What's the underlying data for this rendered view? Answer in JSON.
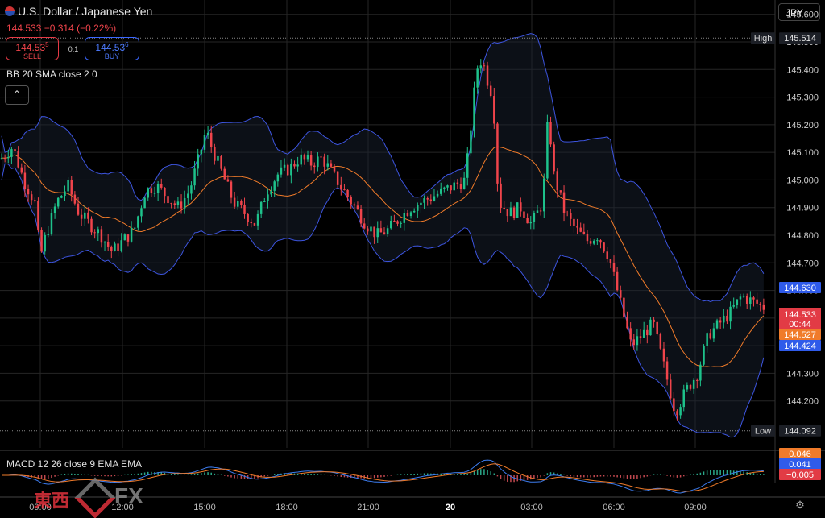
{
  "header": {
    "symbol": "U.S. Dollar / Japanese Yen",
    "last": "144.533",
    "change": "−0.314 (−0.22%)",
    "sell_price": "144.53",
    "sell_sup": "5",
    "sell_label": "SELL",
    "buy_price": "144.53",
    "buy_sup": "6",
    "buy_label": "BUY",
    "spread": "0.1",
    "currency": "JPY",
    "collapse_icon": "chevron-up-icon"
  },
  "indicators": {
    "bb_label": "BB 20 SMA close 2 0",
    "macd_label": "MACD 12 26 close 9 EMA EMA"
  },
  "logo": {
    "kanji": "東西",
    "text": "FX"
  },
  "colors": {
    "up": "#1ec28b",
    "down": "#f0444b",
    "bb_band": "#3d55e0",
    "bb_basis": "#f07b2a",
    "macd": "#3d7df0",
    "signal": "#f07b2a",
    "grid": "#262626"
  },
  "chart_data": {
    "type": "candlestick",
    "title": "U.S. Dollar / Japanese Yen",
    "ylim": [
      144.03,
      145.64
    ],
    "y_ticks": [
      "145.600",
      "145.500",
      "145.400",
      "145.300",
      "145.200",
      "145.100",
      "145.000",
      "144.900",
      "144.800",
      "144.700",
      "144.600",
      "144.500",
      "144.400",
      "144.300",
      "144.200"
    ],
    "x_ticks": [
      "09:00",
      "12:00",
      "15:00",
      "18:00",
      "21:00",
      "20",
      "03:00",
      "06:00",
      "09:00"
    ],
    "high": {
      "label": "High",
      "value": "145.514"
    },
    "low": {
      "label": "Low",
      "value": "144.092"
    },
    "upper_band_value": "144.630",
    "last_price": "144.533",
    "countdown": "00:44",
    "basis_value": "144.527",
    "lower_band_value": "144.424",
    "close_path": [
      [
        0,
        145.08
      ],
      [
        2,
        145.12
      ],
      [
        4,
        145.0
      ],
      [
        6,
        144.92
      ],
      [
        7,
        144.72
      ],
      [
        8,
        144.8
      ],
      [
        10,
        144.92
      ],
      [
        12,
        144.98
      ],
      [
        14,
        144.88
      ],
      [
        16,
        144.84
      ],
      [
        18,
        144.8
      ],
      [
        20,
        144.74
      ],
      [
        22,
        144.78
      ],
      [
        24,
        144.82
      ],
      [
        26,
        144.96
      ],
      [
        28,
        144.98
      ],
      [
        30,
        144.94
      ],
      [
        32,
        144.9
      ],
      [
        34,
        144.96
      ],
      [
        36,
        145.1
      ],
      [
        37,
        145.18
      ],
      [
        38,
        145.12
      ],
      [
        40,
        145.02
      ],
      [
        42,
        144.92
      ],
      [
        44,
        144.88
      ],
      [
        46,
        144.84
      ],
      [
        48,
        144.96
      ],
      [
        50,
        145.02
      ],
      [
        52,
        145.04
      ],
      [
        54,
        145.08
      ],
      [
        56,
        145.06
      ],
      [
        58,
        145.08
      ],
      [
        60,
        145.02
      ],
      [
        62,
        144.96
      ],
      [
        64,
        144.9
      ],
      [
        66,
        144.84
      ],
      [
        68,
        144.8
      ],
      [
        70,
        144.82
      ],
      [
        72,
        144.86
      ],
      [
        74,
        144.9
      ],
      [
        76,
        144.92
      ],
      [
        78,
        144.94
      ],
      [
        80,
        144.96
      ],
      [
        82,
        144.98
      ],
      [
        84,
        145.0
      ],
      [
        86,
        145.4
      ],
      [
        87,
        145.44
      ],
      [
        88,
        145.36
      ],
      [
        89,
        145.3
      ],
      [
        90,
        144.92
      ],
      [
        92,
        144.88
      ],
      [
        94,
        144.9
      ],
      [
        96,
        144.84
      ],
      [
        98,
        144.92
      ],
      [
        99,
        145.24
      ],
      [
        100,
        145.02
      ],
      [
        102,
        144.88
      ],
      [
        104,
        144.82
      ],
      [
        106,
        144.78
      ],
      [
        108,
        144.8
      ],
      [
        110,
        144.72
      ],
      [
        112,
        144.56
      ],
      [
        114,
        144.4
      ],
      [
        116,
        144.44
      ],
      [
        118,
        144.48
      ],
      [
        120,
        144.32
      ],
      [
        122,
        144.16
      ],
      [
        124,
        144.24
      ],
      [
        126,
        144.3
      ],
      [
        128,
        144.44
      ],
      [
        130,
        144.48
      ],
      [
        132,
        144.52
      ],
      [
        134,
        144.58
      ],
      [
        136,
        144.56
      ],
      [
        138,
        144.54
      ]
    ],
    "macd": {
      "value": "0.041",
      "signal": "0.046",
      "hist": "−0.005"
    }
  }
}
